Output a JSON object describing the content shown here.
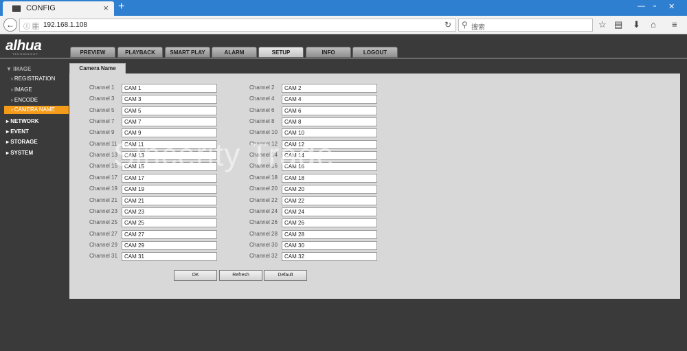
{
  "browser": {
    "tab_title": "CONFIG",
    "new_tab": "+",
    "address": "192.168.1.108",
    "search_placeholder": "搜索",
    "win_min": "—",
    "win_max": "▫",
    "win_close": "✕"
  },
  "app": {
    "logo": "alhua",
    "logo_sub": "TECHNOLOGY",
    "main_tabs": [
      "PREVIEW",
      "PLAYBACK",
      "SMART PLAY",
      "ALARM",
      "SETUP",
      "INFO",
      "LOGOUT"
    ],
    "active_tab": "SETUP"
  },
  "sidebar": {
    "top": "▼ IMAGE",
    "items": [
      "REGISTRATION",
      "IMAGE",
      "ENCODE",
      "CAMERA NAME"
    ],
    "active": "CAMERA NAME",
    "groups": [
      "NETWORK",
      "EVENT",
      "STORAGE",
      "SYSTEM"
    ]
  },
  "panel": {
    "title": "Camera Name",
    "channels": [
      {
        "label": "Channel 1",
        "value": "CAM 1"
      },
      {
        "label": "Channel 2",
        "value": "CAM 2"
      },
      {
        "label": "Channel 3",
        "value": "CAM 3"
      },
      {
        "label": "Channel 4",
        "value": "CAM 4"
      },
      {
        "label": "Channel 5",
        "value": "CAM 5"
      },
      {
        "label": "Channel 6",
        "value": "CAM 6"
      },
      {
        "label": "Channel 7",
        "value": "CAM 7"
      },
      {
        "label": "Channel 8",
        "value": "CAM 8"
      },
      {
        "label": "Channel 9",
        "value": "CAM 9"
      },
      {
        "label": "Channel 10",
        "value": "CAM 10"
      },
      {
        "label": "Channel 11",
        "value": "CAM 11"
      },
      {
        "label": "Channel 12",
        "value": "CAM 12"
      },
      {
        "label": "Channel 13",
        "value": "CAM 13"
      },
      {
        "label": "Channel 14",
        "value": "CAM 14"
      },
      {
        "label": "Channel 15",
        "value": "CAM 15"
      },
      {
        "label": "Channel 16",
        "value": "CAM 16"
      },
      {
        "label": "Channel 17",
        "value": "CAM 17"
      },
      {
        "label": "Channel 18",
        "value": "CAM 18"
      },
      {
        "label": "Channel 19",
        "value": "CAM 19"
      },
      {
        "label": "Channel 20",
        "value": "CAM 20"
      },
      {
        "label": "Channel 21",
        "value": "CAM 21"
      },
      {
        "label": "Channel 22",
        "value": "CAM 22"
      },
      {
        "label": "Channel 23",
        "value": "CAM 23"
      },
      {
        "label": "Channel 24",
        "value": "CAM 24"
      },
      {
        "label": "Channel 25",
        "value": "CAM 25"
      },
      {
        "label": "Channel 26",
        "value": "CAM 26"
      },
      {
        "label": "Channel 27",
        "value": "CAM 27"
      },
      {
        "label": "Channel 28",
        "value": "CAM 28"
      },
      {
        "label": "Channel 29",
        "value": "CAM 29"
      },
      {
        "label": "Channel 30",
        "value": "CAM 30"
      },
      {
        "label": "Channel 31",
        "value": "CAM 31"
      },
      {
        "label": "Channel 32",
        "value": "CAM 32"
      }
    ],
    "buttons": {
      "ok": "OK",
      "refresh": "Refresh",
      "default": "Default"
    }
  },
  "watermark": "Sincerity Trade",
  "colors": {
    "accent": "#f59b1a",
    "chrome": "#2f7fd0"
  }
}
